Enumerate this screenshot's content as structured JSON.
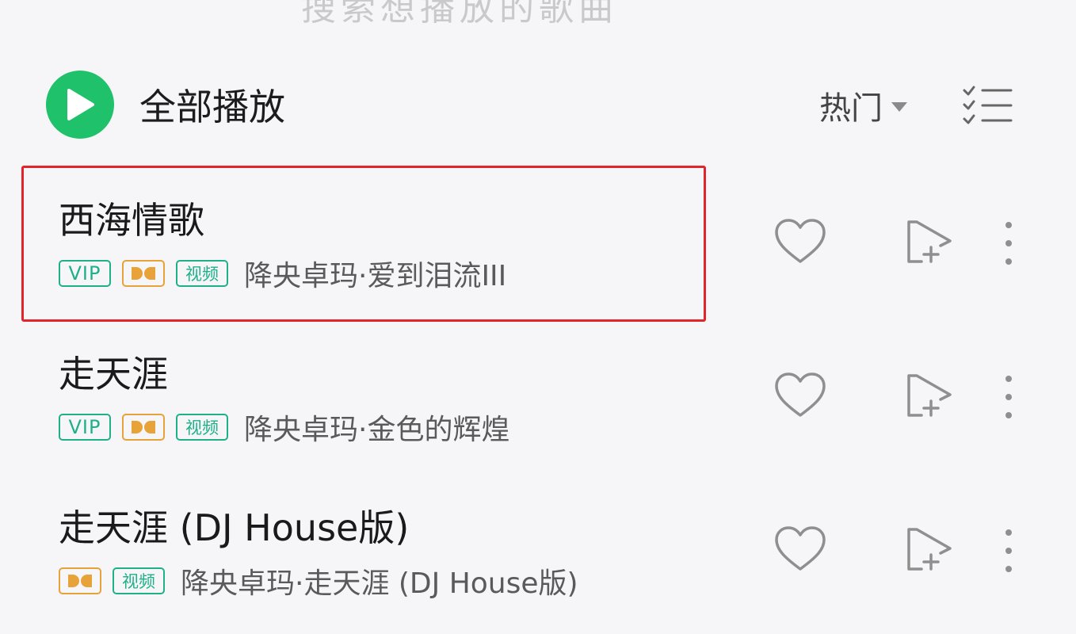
{
  "header": {
    "cut_text": "搜索想播放的歌曲",
    "play_all_label": "全部播放",
    "sort_label": "热门"
  },
  "songs": [
    {
      "title": "西海情歌",
      "tags": [
        "VIP",
        "dolby",
        "视频"
      ],
      "meta": "降央卓玛·爱到泪流III",
      "highlighted": true
    },
    {
      "title": "走天涯",
      "tags": [
        "VIP",
        "dolby",
        "视频"
      ],
      "meta": "降央卓玛·金色的辉煌",
      "highlighted": false
    },
    {
      "title": "走天涯 (DJ House版)",
      "tags": [
        "dolby",
        "视频"
      ],
      "meta": "降央卓玛·走天涯 (DJ House版)",
      "highlighted": false
    }
  ],
  "tag_labels": {
    "vip": "VIP",
    "video": "视频"
  },
  "colors": {
    "accent_green": "#1fc26a",
    "tag_green": "#1fb08a",
    "dolby_orange": "#e8a23a",
    "highlight_red": "#e0252b"
  },
  "icons": {
    "play": "play-icon",
    "sort_arrow": "triangle-down-icon",
    "multi_select": "checklist-icon",
    "like": "heart-icon",
    "add_to_playlist": "add-to-playlist-icon",
    "more": "more-vertical-icon",
    "dolby": "dolby-icon"
  }
}
